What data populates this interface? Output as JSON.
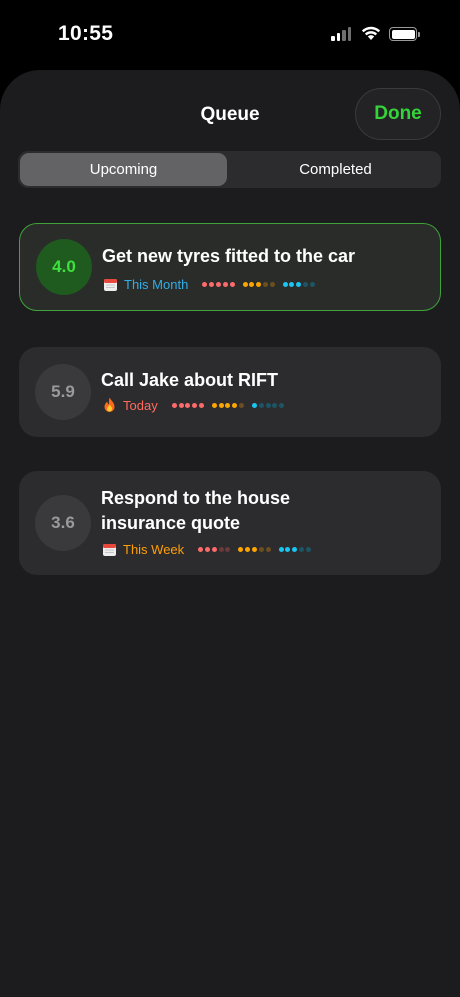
{
  "status_bar": {
    "time": "10:55"
  },
  "sheet": {
    "title": "Queue",
    "done_label": "Done",
    "segments": [
      {
        "label": "Upcoming",
        "selected": true
      },
      {
        "label": "Completed",
        "selected": false
      }
    ]
  },
  "tasks": [
    {
      "score": "4.0",
      "title_lines": [
        "Get new tyres fitted to the car"
      ],
      "due": "This Month",
      "due_icon": "calendar-icon",
      "due_color": "#32ade6",
      "ratings": [
        5,
        3,
        3
      ],
      "selected": true
    },
    {
      "score": "5.9",
      "title_lines": [
        "Call Jake about RIFT"
      ],
      "due": "Today",
      "due_icon": "fire-icon",
      "due_color": "#ff6b5f",
      "ratings": [
        5,
        4,
        1
      ],
      "selected": false
    },
    {
      "score": "3.6",
      "title_lines": [
        "Respond to the house",
        "insurance quote"
      ],
      "due": "This Week",
      "due_icon": "calendar-icon",
      "due_color": "#ff9f0a",
      "ratings": [
        3,
        3,
        3
      ],
      "selected": false
    }
  ],
  "rating_colors": [
    "#ff6b6b",
    "#ffa500",
    "#19c5f2"
  ],
  "rating_dim_colors": [
    "#6b3a3a",
    "#6b4f1f",
    "#1d5565"
  ]
}
